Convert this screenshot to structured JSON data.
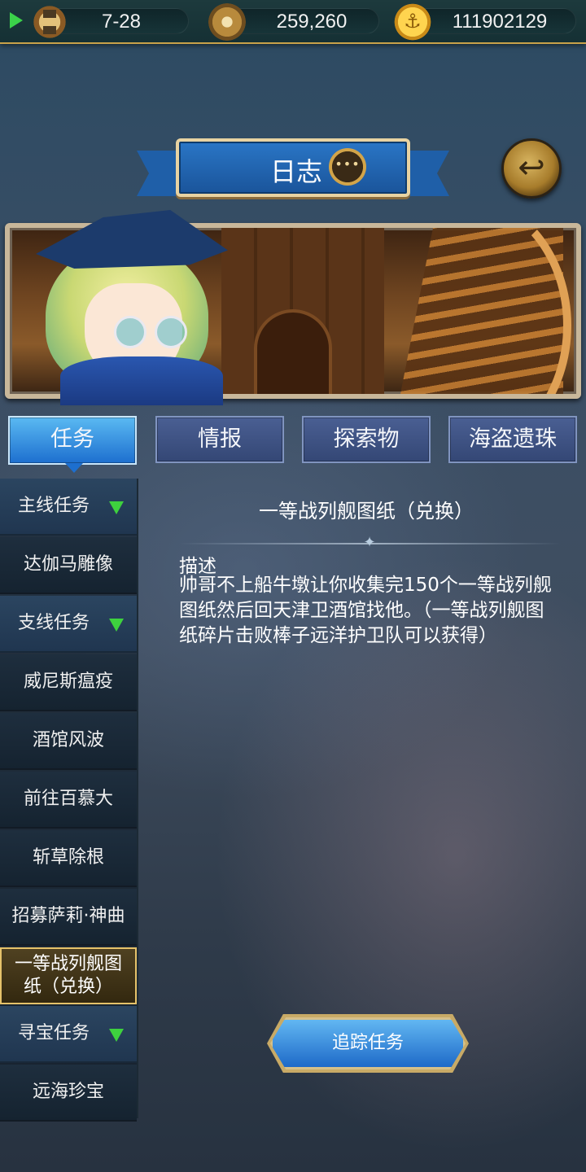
{
  "status_bar": {
    "time_value": "7-28",
    "compass_value": "259,260",
    "gold_value": "111902129"
  },
  "header": {
    "title": "日志"
  },
  "tabs": [
    {
      "label": "任务",
      "active": true
    },
    {
      "label": "情报",
      "active": false
    },
    {
      "label": "探索物",
      "active": false
    },
    {
      "label": "海盗遗珠",
      "active": false
    }
  ],
  "sidebar": {
    "items": [
      {
        "label": "主线任务",
        "type": "category"
      },
      {
        "label": "达伽马雕像",
        "type": "quest"
      },
      {
        "label": "支线任务",
        "type": "category"
      },
      {
        "label": "威尼斯瘟疫",
        "type": "quest"
      },
      {
        "label": "酒馆风波",
        "type": "quest"
      },
      {
        "label": "前往百慕大",
        "type": "quest"
      },
      {
        "label": "斩草除根",
        "type": "quest"
      },
      {
        "label": "招募萨莉·神曲",
        "type": "quest"
      },
      {
        "label": "一等战列舰图纸（兑换）",
        "type": "quest",
        "selected": true
      },
      {
        "label": "寻宝任务",
        "type": "category"
      },
      {
        "label": "远海珍宝",
        "type": "quest"
      }
    ]
  },
  "detail": {
    "title": "一等战列舰图纸（兑换）",
    "description_label": "描述",
    "description": "帅哥不上船牛墩让你收集完150个一等战列舰图纸然后回天津卫酒馆找他。（一等战列舰图纸碎片击败棒子远洋护卫队可以获得）"
  },
  "track_button_label": "追踪任务",
  "colors": {
    "accent_blue": "#1d6fcf",
    "gold_trim": "#e5c26a",
    "category_arrow": "#3ed13e"
  }
}
